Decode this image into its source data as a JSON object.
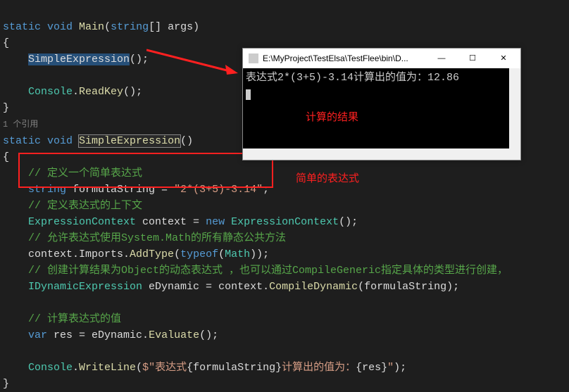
{
  "code": {
    "sig1_kw": "static void",
    "sig1_name": "Main",
    "sig1_param_type": "string",
    "sig1_param": "[] args",
    "brace_open": "{",
    "call_se": "SimpleExpression",
    "call_se_paren": "();",
    "readkey_obj": "Console",
    "readkey_dot": ".",
    "readkey_m": "ReadKey",
    "readkey_paren": "();",
    "brace_close": "}",
    "refcount": "1 个引用",
    "sig2_kw": "static void",
    "sig2_name": "SimpleExpression",
    "sig2_paren": "()",
    "c1": "// 定义一个简单表达式",
    "decl_type": "string",
    "decl_name": " formulaString = ",
    "decl_val": "\"2*(3+5)-3.14\"",
    "decl_semi": ";",
    "c2": "// 定义表达式的上下文",
    "ctx_type": "ExpressionContext",
    "ctx_var": " context = ",
    "ctx_new": "new",
    "ctx_ctor": "ExpressionContext",
    "ctx_end": "();",
    "c3": "// 允许表达式使用System.Math的所有静态公共方法",
    "imp_obj": "context.Imports.",
    "imp_m": "AddType",
    "imp_open": "(",
    "imp_typeof": "typeof",
    "imp_open2": "(",
    "imp_math": "Math",
    "imp_close": "));",
    "c4": "// 创建计算结果为Object的动态表达式 ，也可以通过CompileGeneric指定具体的类型进行创建，",
    "dyn_type": "IDynamicExpression",
    "dyn_var": " eDynamic = context.",
    "dyn_m": "CompileDynamic",
    "dyn_arg": "(formulaString);",
    "c5": "// 计算表达式的值",
    "eval_kw": "var",
    "eval_var": " res = eDynamic.",
    "eval_m": "Evaluate",
    "eval_end": "();",
    "write_obj": "Console",
    "write_dot": ".",
    "write_m": "WriteLine",
    "write_open": "(",
    "write_str1": "$\"表达式",
    "write_inter1": "{formulaString}",
    "write_str2": "计算出的值为：",
    "write_inter2": "{res}",
    "write_str3": "\"",
    "write_close": ");"
  },
  "console": {
    "title": "E:\\MyProject\\TestElsa\\TestFlee\\bin\\D...",
    "output": "表达式2*(3+5)-3.14计算出的值为：12.86"
  },
  "annotations": {
    "result": "计算的结果",
    "expr": "简单的表达式"
  }
}
